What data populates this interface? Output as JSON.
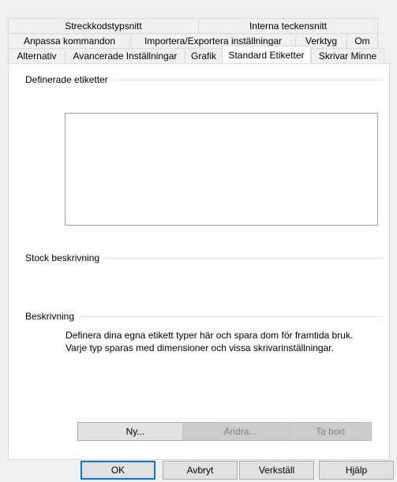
{
  "tabs": {
    "row1": [
      "Streckkodstypsnitt",
      "Interna teckensnitt"
    ],
    "row2": [
      "Anpassa kommandon",
      "Importera/Exportera inställningar",
      "Verktyg",
      "Om"
    ],
    "row3": [
      "Alternativ",
      "Avancerade Inställningar",
      "Grafik",
      "Standard Etiketter",
      "Skrivar Minne"
    ],
    "active": "Standard Etiketter"
  },
  "panel": {
    "defined_labels_title": "Definerade etiketter",
    "defined_labels_items": [],
    "stock_title": "Stock beskrivning",
    "description_title": "Beskrivning",
    "description_lines": [
      "Definera dina egna etikett typer här och spara dom för framtida bruk.",
      "Varje typ sparas med dimensioner och vissa skrivarinställningar."
    ],
    "buttons": {
      "new": "Ny...",
      "edit": "Ändra...",
      "delete": "Ta bort"
    }
  },
  "dialog_buttons": {
    "ok": "OK",
    "cancel": "Avbryt",
    "apply": "Verkställ",
    "help": "Hjälp"
  }
}
